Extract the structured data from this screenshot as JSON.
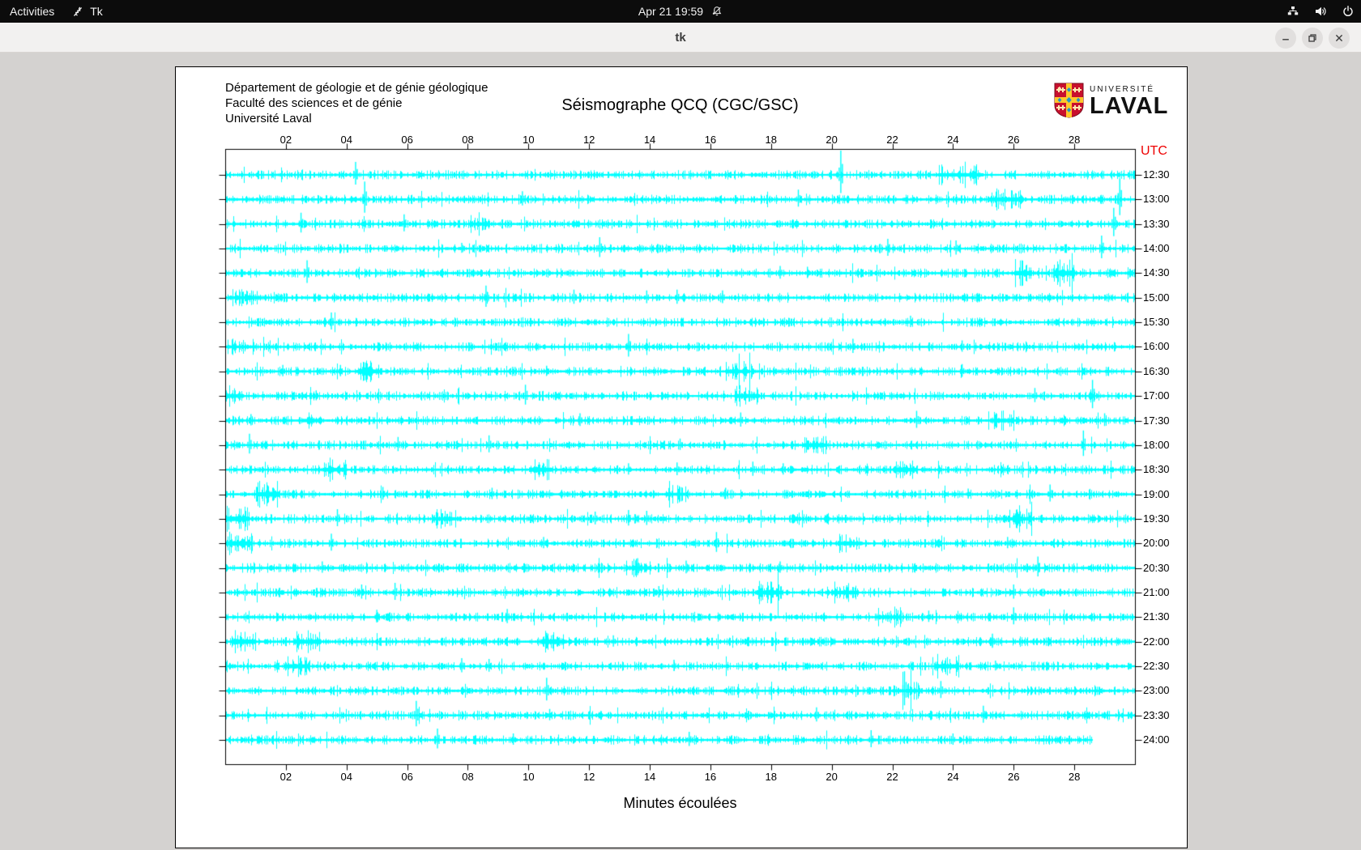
{
  "desktop": {
    "activities_label": "Activities",
    "app_indicator": "Tk",
    "clock": "Apr 21 19:59",
    "status_icons": [
      "network-icon",
      "volume-icon",
      "power-icon"
    ],
    "notifications_muted": true
  },
  "window": {
    "title": "tk",
    "controls": [
      "minimize",
      "maximize",
      "close"
    ]
  },
  "header": {
    "dept_line1": "Département de géologie et de génie géologique",
    "dept_line2": "Faculté des sciences et de génie",
    "dept_line3": "Université Laval",
    "title": "Séismographe QCQ (CGC/GSC)",
    "logo_line1": "UNIVERSITÉ",
    "logo_line2": "LAVAL"
  },
  "chart": {
    "type": "seismograph-helicorder",
    "utc_label": "UTC",
    "xlabel": "Minutes écoulées",
    "x_range_minutes": [
      0,
      30
    ],
    "x_tick_minutes": [
      2,
      4,
      6,
      8,
      10,
      12,
      14,
      16,
      18,
      20,
      22,
      24,
      26,
      28
    ],
    "x_tick_labels": [
      "02",
      "04",
      "06",
      "08",
      "10",
      "12",
      "14",
      "16",
      "18",
      "20",
      "22",
      "24",
      "26",
      "28"
    ],
    "trace_color": "#00ffff",
    "utc_color": "#ee0000",
    "rows": [
      {
        "label": "12:30",
        "seed": 11,
        "spikes": [
          [
            4.3,
            16
          ],
          [
            20.3,
            30
          ]
        ],
        "bursts": [
          [
            23.5,
            25.0,
            2.2
          ]
        ]
      },
      {
        "label": "13:00",
        "seed": 12,
        "spikes": [
          [
            4.6,
            22
          ],
          [
            9.8,
            10
          ],
          [
            18.9,
            12
          ],
          [
            29.5,
            26
          ]
        ],
        "bursts": [
          [
            25.2,
            26.3,
            2.5
          ]
        ]
      },
      {
        "label": "13:30",
        "seed": 13,
        "spikes": [
          [
            2.5,
            14
          ],
          [
            5.9,
            12
          ],
          [
            29.3,
            20
          ]
        ],
        "bursts": [
          [
            8.0,
            8.6,
            2.0
          ]
        ]
      },
      {
        "label": "14:00",
        "seed": 14,
        "spikes": [
          [
            7.8,
            7
          ],
          [
            12.35,
            14
          ],
          [
            21.85,
            12
          ],
          [
            24.1,
            10
          ],
          [
            28.9,
            16
          ]
        ],
        "bursts": []
      },
      {
        "label": "14:30",
        "seed": 15,
        "spikes": [
          [
            2.7,
            16
          ],
          [
            18.3,
            9
          ],
          [
            19.2,
            8
          ]
        ],
        "bursts": [
          [
            26.0,
            26.6,
            3.0
          ],
          [
            27.3,
            28.0,
            3.0
          ]
        ]
      },
      {
        "label": "15:00",
        "seed": 16,
        "spikes": [
          [
            8.6,
            15
          ],
          [
            11.5,
            10
          ],
          [
            13.9,
            9
          ],
          [
            14.9,
            10
          ],
          [
            16.4,
            9
          ]
        ],
        "bursts": [
          [
            0.2,
            1.2,
            2.0
          ]
        ]
      },
      {
        "label": "15:30",
        "seed": 17,
        "spikes": [
          [
            3.5,
            12
          ],
          [
            22.6,
            8
          ]
        ],
        "bursts": []
      },
      {
        "label": "16:00",
        "seed": 18,
        "spikes": [
          [
            13.3,
            16
          ],
          [
            20.7,
            10
          ],
          [
            24.3,
            8
          ]
        ],
        "bursts": [
          [
            0.0,
            1.0,
            1.8
          ]
        ]
      },
      {
        "label": "16:30",
        "seed": 19,
        "spikes": [
          [
            1.9,
            8
          ],
          [
            3.8,
            8
          ],
          [
            10.6,
            7
          ],
          [
            24.3,
            9
          ]
        ],
        "bursts": [
          [
            4.4,
            5.0,
            2.6
          ],
          [
            16.5,
            17.3,
            2.2
          ]
        ]
      },
      {
        "label": "17:00",
        "seed": 20,
        "spikes": [
          [
            3.0,
            7
          ],
          [
            9.9,
            14
          ],
          [
            26.7,
            10
          ],
          [
            28.6,
            20
          ]
        ],
        "bursts": [
          [
            0.0,
            0.6,
            2.4
          ],
          [
            16.8,
            17.6,
            2.6
          ]
        ]
      },
      {
        "label": "17:30",
        "seed": 21,
        "spikes": [
          [
            0.85,
            8
          ],
          [
            11.7,
            9
          ],
          [
            17.0,
            10
          ],
          [
            22.8,
            12
          ],
          [
            29.0,
            9
          ]
        ],
        "bursts": [
          [
            2.5,
            3.2,
            2.2
          ],
          [
            25.2,
            26.0,
            2.4
          ]
        ]
      },
      {
        "label": "18:00",
        "seed": 22,
        "spikes": [
          [
            0.8,
            14
          ],
          [
            5.7,
            10
          ],
          [
            8.7,
            12
          ],
          [
            15.0,
            8
          ],
          [
            28.3,
            18
          ]
        ],
        "bursts": [
          [
            19.0,
            19.8,
            2.4
          ]
        ]
      },
      {
        "label": "18:30",
        "seed": 23,
        "spikes": [
          [
            13.3,
            8
          ],
          [
            14.9,
            9
          ],
          [
            17.4,
            10
          ],
          [
            18.4,
            8
          ]
        ],
        "bursts": [
          [
            3.2,
            4.0,
            2.4
          ],
          [
            10.0,
            10.8,
            2.6
          ],
          [
            22.0,
            22.8,
            2.4
          ]
        ]
      },
      {
        "label": "19:00",
        "seed": 24,
        "spikes": [
          [
            5.2,
            9
          ],
          [
            8.8,
            8
          ],
          [
            16.5,
            8
          ],
          [
            24.5,
            7
          ],
          [
            27.2,
            12
          ]
        ],
        "bursts": [
          [
            1.0,
            1.8,
            2.8
          ],
          [
            14.5,
            15.2,
            2.0
          ]
        ]
      },
      {
        "label": "19:30",
        "seed": 25,
        "spikes": [
          [
            3.7,
            12
          ],
          [
            12.2,
            9
          ],
          [
            13.3,
            11
          ],
          [
            13.9,
            10
          ],
          [
            26.5,
            8
          ]
        ],
        "bursts": [
          [
            0.0,
            0.8,
            3.0
          ],
          [
            6.8,
            7.6,
            2.2
          ],
          [
            25.8,
            26.6,
            2.2
          ]
        ]
      },
      {
        "label": "20:00",
        "seed": 26,
        "spikes": [
          [
            3.5,
            12
          ],
          [
            10.5,
            8
          ],
          [
            16.2,
            14
          ],
          [
            20.6,
            7
          ],
          [
            25.8,
            8
          ]
        ],
        "bursts": [
          [
            0.0,
            0.9,
            2.8
          ],
          [
            20.2,
            21.0,
            2.2
          ]
        ]
      },
      {
        "label": "20:30",
        "seed": 27,
        "spikes": [
          [
            3.2,
            8
          ],
          [
            13.6,
            12
          ],
          [
            15.2,
            9
          ],
          [
            18.3,
            8
          ],
          [
            26.8,
            14
          ]
        ],
        "bursts": [
          [
            13.2,
            14.0,
            2.2
          ]
        ]
      },
      {
        "label": "21:00",
        "seed": 28,
        "spikes": [
          [
            4.5,
            10
          ],
          [
            5.6,
            12
          ],
          [
            14.3,
            8
          ],
          [
            20.5,
            9
          ],
          [
            26.0,
            10
          ]
        ],
        "bursts": [
          [
            17.5,
            18.4,
            2.6
          ],
          [
            20.0,
            20.8,
            2.4
          ]
        ]
      },
      {
        "label": "21:30",
        "seed": 29,
        "spikes": [
          [
            5.0,
            9
          ],
          [
            9.3,
            10
          ],
          [
            23.2,
            8
          ],
          [
            26.0,
            12
          ]
        ],
        "bursts": [
          [
            21.5,
            22.3,
            2.2
          ]
        ]
      },
      {
        "label": "22:00",
        "seed": 30,
        "spikes": [
          [
            10.6,
            11
          ],
          [
            12.8,
            8
          ],
          [
            25.3,
            10
          ]
        ],
        "bursts": [
          [
            0.2,
            1.0,
            2.8
          ],
          [
            2.3,
            3.1,
            2.6
          ],
          [
            10.4,
            11.2,
            2.4
          ]
        ]
      },
      {
        "label": "22:30",
        "seed": 31,
        "spikes": [
          [
            7.8,
            10
          ],
          [
            8.7,
            9
          ],
          [
            14.8,
            8
          ],
          [
            25.4,
            7
          ]
        ],
        "bursts": [
          [
            2.0,
            2.8,
            2.6
          ],
          [
            23.4,
            24.2,
            2.4
          ]
        ]
      },
      {
        "label": "23:00",
        "seed": 32,
        "spikes": [
          [
            10.6,
            16
          ],
          [
            22.4,
            24
          ],
          [
            23.6,
            12
          ]
        ],
        "bursts": [
          [
            22.0,
            23.0,
            2.0
          ]
        ]
      },
      {
        "label": "23:30",
        "seed": 33,
        "spikes": [
          [
            6.3,
            18
          ],
          [
            10.7,
            8
          ],
          [
            19.5,
            10
          ],
          [
            25.0,
            12
          ]
        ],
        "bursts": []
      },
      {
        "label": "24:00",
        "seed": 34,
        "end": 28.6,
        "spikes": [
          [
            7.0,
            14
          ],
          [
            9.5,
            8
          ],
          [
            15.3,
            10
          ],
          [
            21.3,
            12
          ],
          [
            24.0,
            8
          ]
        ],
        "bursts": []
      }
    ]
  }
}
